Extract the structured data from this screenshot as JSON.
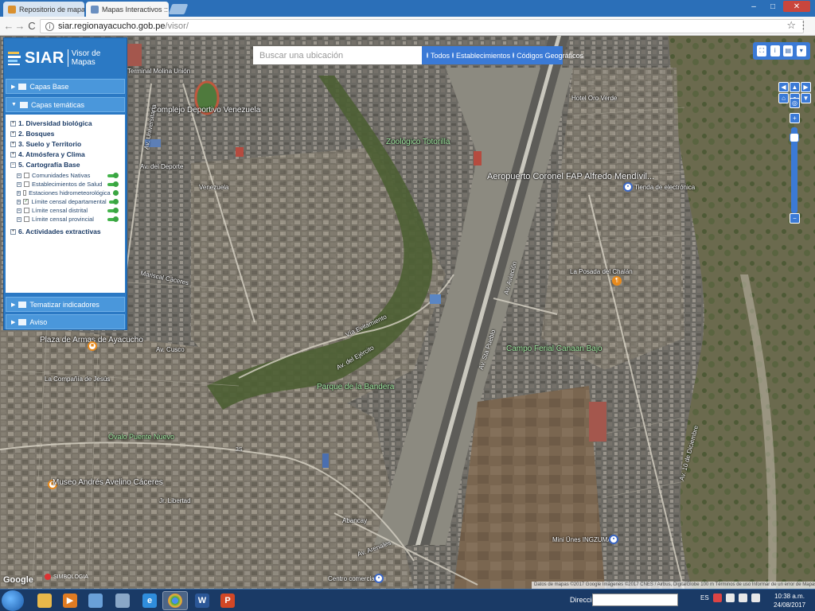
{
  "browser": {
    "tabs": [
      {
        "title": "Repositorio de mapas | S",
        "active": false,
        "favicon_color": "#d9902f"
      },
      {
        "title": "Mapas Interactivos :: SIA",
        "active": true,
        "favicon_color": "#6a8fc0"
      }
    ],
    "tab_close": "×",
    "url_domain": "siar.regionayacucho.gob.pe",
    "url_path": "/visor/",
    "back": "←",
    "forward": "→",
    "reload": "C",
    "star": "☆",
    "menu": "⋮",
    "window_controls": [
      "–",
      "□",
      "✕"
    ]
  },
  "app": {
    "logo_text": "SIAR",
    "logo_subtitle": "Visor de Mapas",
    "search": {
      "placeholder": "Buscar una ubicación",
      "options": [
        "Todos",
        "Establecimientos",
        "Códigos Geográficos"
      ],
      "selected": "Todos"
    },
    "panel": {
      "sections": {
        "base": "Capas Base",
        "thematic": "Capas temáticas",
        "indicators": "Tematizar indicadores",
        "notice": "Aviso"
      },
      "tree": [
        {
          "label": "1. Diversidad biológica"
        },
        {
          "label": "2. Bosques"
        },
        {
          "label": "3. Suelo y Territorio"
        },
        {
          "label": "4. Atmósfera y Clima"
        },
        {
          "label": "5. Cartografía Base"
        },
        {
          "label": "6. Actividades extractivas"
        }
      ],
      "layers": [
        {
          "label": "Comunidades Nativas",
          "checked": false
        },
        {
          "label": "Establecimientos de Salud",
          "checked": false
        },
        {
          "label": "Estaciones hidrometeorológica",
          "checked": false
        },
        {
          "label": "Límite censal departamental",
          "checked": true
        },
        {
          "label": "Límite censal distrital",
          "checked": false
        },
        {
          "label": "Límite censal provincial",
          "checked": false
        }
      ]
    },
    "zoom": {
      "in": "+",
      "out": "−",
      "level": 0.93
    }
  },
  "map": {
    "labels": {
      "terminal": "Terminal Molina Unión",
      "complejo": "Complejo Deportivo Venezuela",
      "zoologico": "Zoológico Totorilla",
      "aeropuerto": "Aeropuerto Coronel FAP Alfredo Mendívil...",
      "hotel": "Hotel Oro Verde",
      "tienda": "Tienda de electrónica",
      "posada": "La Posada del Chalán",
      "campo": "Campo Ferial Canaan Bajo",
      "plaza": "Plaza de Armas de Ayacucho",
      "compania": "La Compañía de Jesús",
      "ovalo": "Óvalo Puente Nuevo",
      "parque": "Parque de la Bandera",
      "museo": "Museo Andrés Avelino Cáceres",
      "minenes": "Mini Ünes INGZUMAR",
      "centro": "Centro comercial",
      "av_evitamiento": "Vía Evitamiento",
      "av_del_ejercito": "Av. del Ejército",
      "av_san_pueblo": "Av. Sta Pueblo",
      "av_arenales": "Av. Arenales",
      "av_universitaria": "Av. Universitaria",
      "av_aviacion": "Av. Aviación",
      "av_10dic": "Av. 10 de Diciembre",
      "av_deporte": "Av. del Deporte",
      "av_venezuela": "Venezuela",
      "av_mariscal": "Mariscal Cáceres",
      "jr_libertad": "Jr. Libertad",
      "av_cusco": "Av. Cusco",
      "av_abancay": "Abancay",
      "ruta_3s": "3S"
    },
    "google": "Google",
    "note": "SIMBOLOGIA",
    "attribution": "Datos de mapas ©2017 Google Imágenes ©2017 CNES / Airbus, DigitalGlobe   100 m   Términos de uso   Informar de un error de Mapas"
  },
  "taskbar": {
    "direccion_label": "Dirección",
    "lang": "ES",
    "time": "10:38 a.m.",
    "date": "24/08/2017",
    "apps": [
      {
        "name": "explorer",
        "color": "#e9b84a",
        "glyph": ""
      },
      {
        "name": "media",
        "color": "#e07b22",
        "glyph": "▶"
      },
      {
        "name": "paint",
        "color": "#6aa0d8",
        "glyph": ""
      },
      {
        "name": "calculator",
        "color": "#8aa7c7",
        "glyph": ""
      },
      {
        "name": "ie",
        "color": "#2f8ddc",
        "glyph": "e"
      },
      {
        "name": "chrome",
        "color": "#3aa845",
        "glyph": ""
      },
      {
        "name": "word",
        "color": "#2b5797",
        "glyph": "W"
      },
      {
        "name": "powerpoint",
        "color": "#d24726",
        "glyph": "P"
      }
    ]
  }
}
